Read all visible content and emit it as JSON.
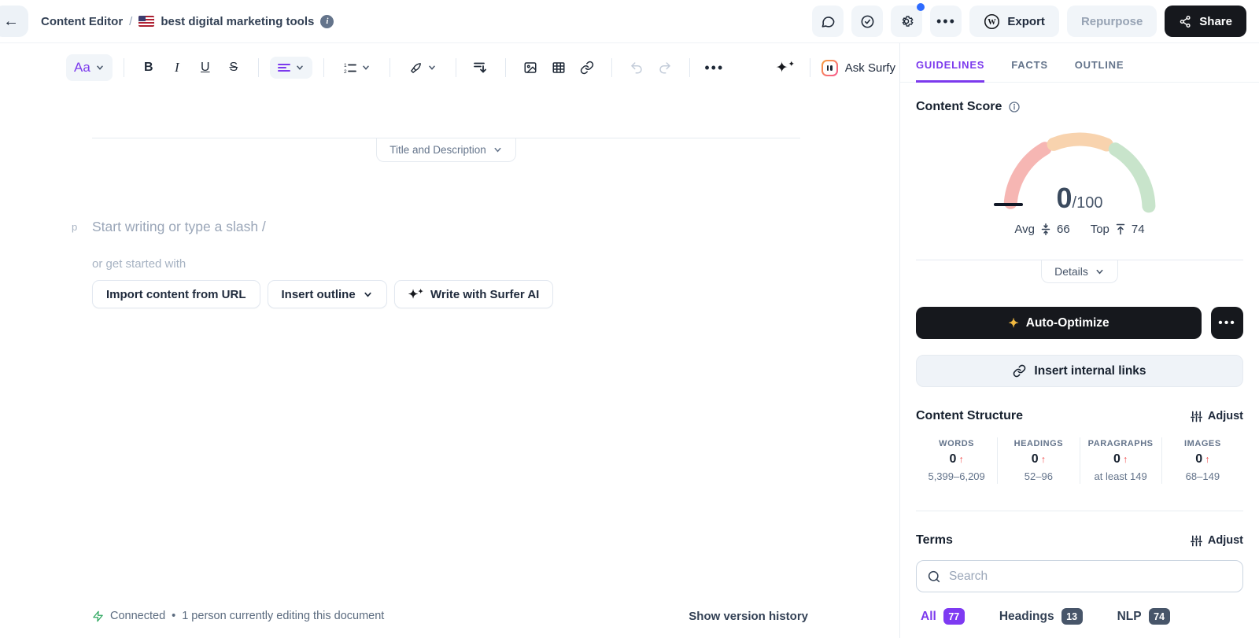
{
  "header": {
    "breadcrumb_section": "Content Editor",
    "breadcrumb_separator": "/",
    "document_title": "best digital marketing tools",
    "export_label": "Export",
    "repurpose_label": "Repurpose",
    "share_label": "Share"
  },
  "toolbar": {
    "text_style_label": "Aa",
    "bold_label": "B",
    "italic_label": "I",
    "underline_label": "U",
    "strikethrough_label": "S",
    "ask_surfy_label": "Ask Surfy"
  },
  "editor": {
    "section_divider_label": "Title and Description",
    "paragraph_marker": "p",
    "placeholder": "Start writing or type a slash /",
    "get_started_label": "or get started with",
    "import_button": "Import content from URL",
    "outline_button": "Insert outline",
    "write_ai_button": "Write with Surfer AI"
  },
  "statusbar": {
    "connection_status": "Connected",
    "separator": "•",
    "editing_info": "1 person currently editing this document",
    "version_history": "Show version history"
  },
  "sidebar": {
    "tabs": [
      {
        "label": "GUIDELINES"
      },
      {
        "label": "FACTS"
      },
      {
        "label": "OUTLINE"
      }
    ],
    "content_score": {
      "title": "Content Score",
      "score": "0",
      "max": "/100",
      "avg_label": "Avg",
      "avg_value": "66",
      "top_label": "Top",
      "top_value": "74",
      "details_label": "Details"
    },
    "auto_optimize_label": "Auto-Optimize",
    "insert_links_label": "Insert internal links",
    "content_structure": {
      "title": "Content Structure",
      "adjust_label": "Adjust",
      "stats": [
        {
          "label": "WORDS",
          "value": "0",
          "range": "5,399–6,209"
        },
        {
          "label": "HEADINGS",
          "value": "0",
          "range": "52–96"
        },
        {
          "label": "PARAGRAPHS",
          "value": "0",
          "range": "at least 149"
        },
        {
          "label": "IMAGES",
          "value": "0",
          "range": "68–149"
        }
      ]
    },
    "terms": {
      "title": "Terms",
      "adjust_label": "Adjust",
      "search_placeholder": "Search",
      "filters": [
        {
          "label": "All",
          "count": "77"
        },
        {
          "label": "Headings",
          "count": "13"
        },
        {
          "label": "NLP",
          "count": "74"
        }
      ]
    }
  },
  "icons": {
    "back-icon": "left arrow",
    "us-flag-icon": "US flag",
    "info-icon": "circled i",
    "comment-icon": "speech bubble",
    "check-circle-icon": "circled checkmark",
    "gear-icon": "settings gear with blue dot",
    "more-icon": "horizontal ellipsis",
    "wordpress-icon": "W in circle",
    "share-icon": "share nodes",
    "align-icon": "alignment lines",
    "numbered-list-icon": "ordered list",
    "pen-icon": "styling pen",
    "indent-icon": "lines with down arrow",
    "image-icon": "picture",
    "table-icon": "grid",
    "link-icon": "chain link",
    "undo-icon": "curved left arrow",
    "redo-icon": "curved right arrow",
    "sparkles-icon": "AI sparkles",
    "surfy-icon": "Surfy gradient square",
    "gauge": "semicircle score gauge red/orange/green",
    "avg-icon": "arrows to middle line",
    "top-icon": "arrow to top line",
    "sliders-icon": "adjust sliders",
    "search-icon": "magnifier",
    "zap-icon": "green lightning bolt"
  },
  "colors": {
    "accent_purple": "#7C3AED",
    "badge_purple": "#7E3AF2",
    "dark_button": "#16181D",
    "gauge_red": "#F6B6B3",
    "gauge_orange": "#F8D3AE",
    "gauge_green": "#C8E4CB",
    "alert_red": "#F05252",
    "connected_green": "#2FA860",
    "notification_blue": "#2E6BFF"
  }
}
